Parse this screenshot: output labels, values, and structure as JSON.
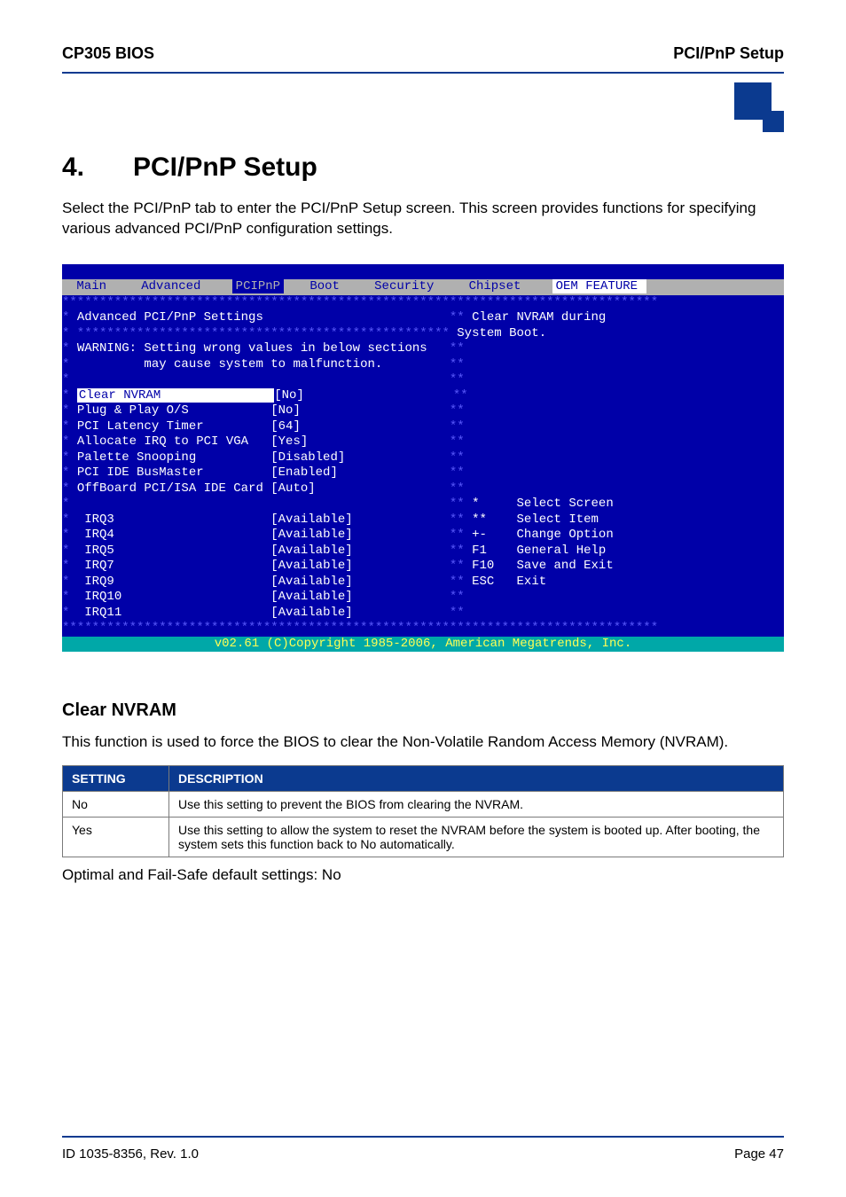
{
  "header": {
    "left": "CP305 BIOS",
    "right": "PCI/PnP Setup"
  },
  "chapter": {
    "number": "4.",
    "title": "PCI/PnP Setup"
  },
  "intro": "Select the PCI/PnP tab to enter the PCI/PnP Setup screen. This screen provides functions for specifying various advanced PCI/PnP configuration settings.",
  "bios": {
    "menubar": {
      "items": [
        "Main",
        "Advanced",
        "PCIPnP",
        "Boot",
        "Security",
        "Chipset",
        "OEM FEATURE"
      ],
      "selected_index": 2
    },
    "heading": "Advanced PCI/PnP Settings",
    "warning": {
      "line1": "WARNING: Setting wrong values in below sections",
      "line2": "         may cause system to malfunction."
    },
    "help": {
      "line1": "Clear NVRAM during",
      "line2": "System Boot."
    },
    "settings": [
      {
        "label": "Clear NVRAM",
        "value": "[No]",
        "selected": true
      },
      {
        "label": "Plug & Play O/S",
        "value": "[No]",
        "selected": false
      },
      {
        "label": "PCI Latency Timer",
        "value": "[64]",
        "selected": false
      },
      {
        "label": "Allocate IRQ to PCI VGA",
        "value": "[Yes]",
        "selected": false
      },
      {
        "label": "Palette Snooping",
        "value": "[Disabled]",
        "selected": false
      },
      {
        "label": "PCI IDE BusMaster",
        "value": "[Enabled]",
        "selected": false
      },
      {
        "label": "OffBoard PCI/ISA IDE Card",
        "value": "[Auto]",
        "selected": false
      }
    ],
    "irqs": [
      {
        "label": "IRQ3",
        "value": "[Available]"
      },
      {
        "label": "IRQ4",
        "value": "[Available]"
      },
      {
        "label": "IRQ5",
        "value": "[Available]"
      },
      {
        "label": "IRQ7",
        "value": "[Available]"
      },
      {
        "label": "IRQ9",
        "value": "[Available]"
      },
      {
        "label": "IRQ10",
        "value": "[Available]"
      },
      {
        "label": "IRQ11",
        "value": "[Available]"
      }
    ],
    "keyhelp": [
      {
        "key": "*",
        "text": "Select Screen"
      },
      {
        "key": "**",
        "text": "Select Item"
      },
      {
        "key": "+-",
        "text": "Change Option"
      },
      {
        "key": "F1",
        "text": "General Help"
      },
      {
        "key": "F10",
        "text": "Save and Exit"
      },
      {
        "key": "ESC",
        "text": "Exit"
      }
    ],
    "copyright": "v02.61 (C)Copyright 1985-2006, American Megatrends, Inc."
  },
  "section": {
    "title": "Clear NVRAM",
    "description": "This function is used to force the BIOS to clear the Non-Volatile Random Access Memory (NVRAM).",
    "table_headers": {
      "setting": "SETTING",
      "description": "DESCRIPTION"
    },
    "rows": [
      {
        "setting": "No",
        "description": "Use this setting to prevent the BIOS from clearing the NVRAM."
      },
      {
        "setting": "Yes",
        "description": "Use this setting to allow the system to reset the NVRAM before the system is booted up. After booting, the system sets this function back to No automatically."
      }
    ],
    "defaults": "Optimal and Fail-Safe default settings: No"
  },
  "footer": {
    "left": "ID 1035-8356, Rev. 1.0",
    "right": "Page 47"
  }
}
